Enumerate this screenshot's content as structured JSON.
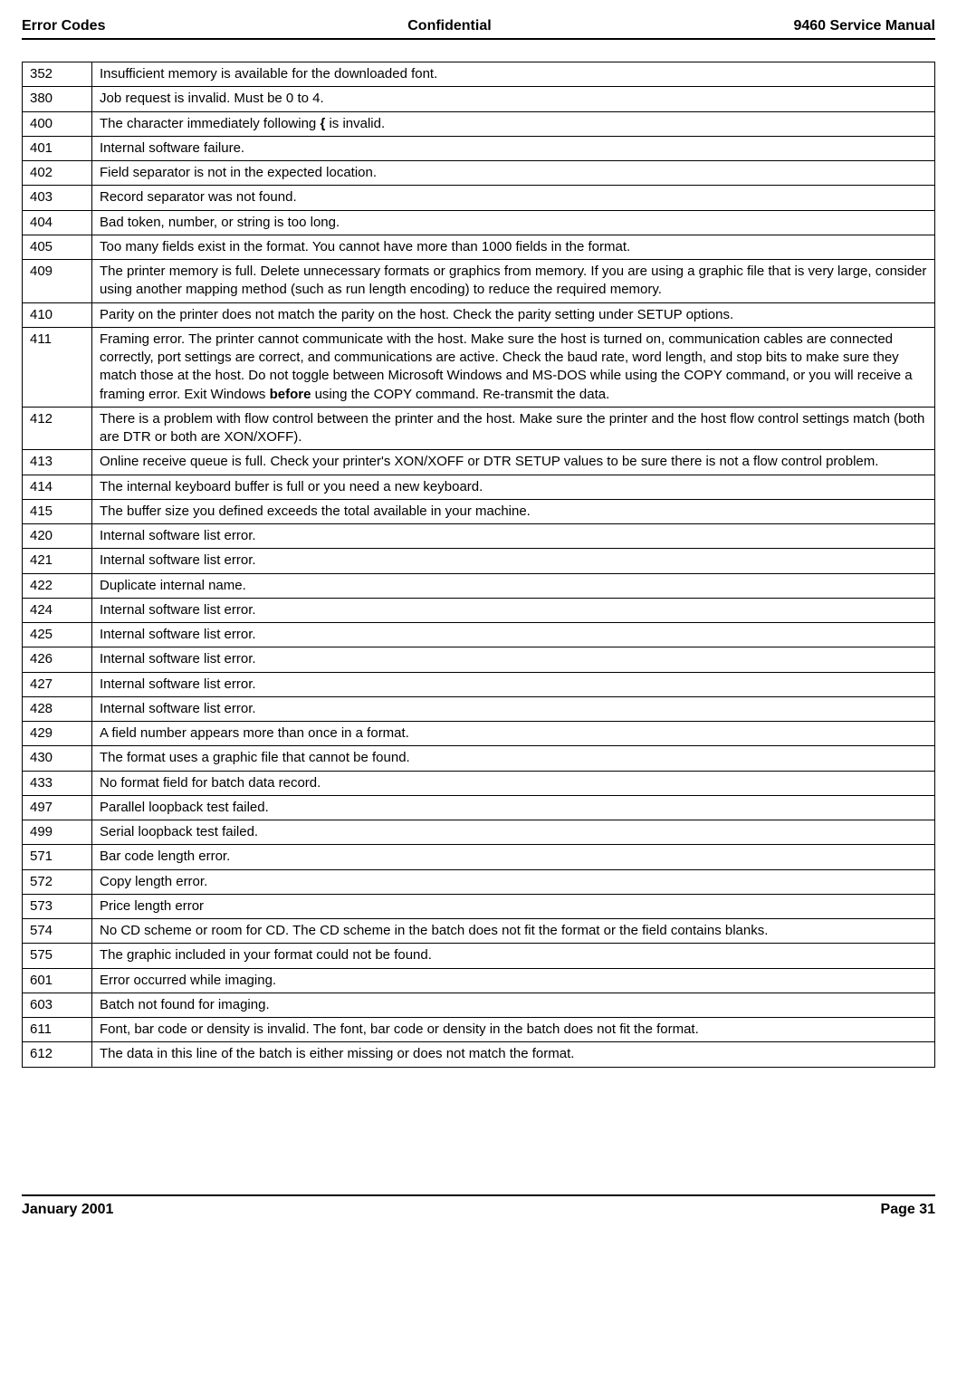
{
  "header": {
    "left": "Error Codes",
    "center": "Confidential",
    "right": "9460 Service Manual"
  },
  "footer": {
    "left": "January 2001",
    "right": "Page 31"
  },
  "rows": [
    {
      "code": "352",
      "desc": "Insufficient memory is available for the downloaded font."
    },
    {
      "code": "380",
      "desc": "Job request is invalid.  Must be 0 to 4."
    },
    {
      "code": "400",
      "desc_html": "The character immediately following <b>{</b> is invalid."
    },
    {
      "code": "401",
      "desc": "Internal software failure."
    },
    {
      "code": "402",
      "desc": "Field separator is not in the expected location."
    },
    {
      "code": "403",
      "desc": "Record separator was not found."
    },
    {
      "code": "404",
      "desc": "Bad token, number, or string is too long."
    },
    {
      "code": "405",
      "desc": "Too many fields exist in the format.  You cannot have more than 1000 fields in the format."
    },
    {
      "code": "409",
      "desc": "The printer memory is full.  Delete unnecessary formats or graphics from memory.  If you are using a graphic file that is very large, consider using another mapping method (such as run length encoding) to reduce the required memory."
    },
    {
      "code": "410",
      "desc": "Parity on the printer does not match the parity on the host.  Check the parity setting under SETUP options."
    },
    {
      "code": "411",
      "desc_html": "Framing error.  The printer cannot communicate with the host.  Make sure the host is turned on, communication cables are connected correctly, port settings are correct, and communications are active.  Check the baud rate, word length, and stop bits to make sure they match those at the host.  Do not toggle between Microsoft Windows and MS-DOS while using the COPY command, or you will receive a framing error.  Exit Windows <b>before</b> using the COPY command.  Re-transmit the data."
    },
    {
      "code": "412",
      "desc": "There is a problem with flow control between the printer and the host.  Make sure the printer and the host flow control settings match (both are DTR or both are XON/XOFF)."
    },
    {
      "code": "413",
      "desc": "Online receive queue is full.  Check your printer's XON/XOFF or DTR SETUP values to be sure there is not a flow control problem."
    },
    {
      "code": "414",
      "desc": "The internal keyboard buffer is full or you need a new keyboard."
    },
    {
      "code": "415",
      "desc": "The buffer size you defined exceeds the total available in your machine."
    },
    {
      "code": "420",
      "desc": "Internal software list error."
    },
    {
      "code": "421",
      "desc": "Internal software list error."
    },
    {
      "code": "422",
      "desc": "Duplicate internal name."
    },
    {
      "code": "424",
      "desc": "Internal software list error."
    },
    {
      "code": "425",
      "desc": "Internal software list error."
    },
    {
      "code": "426",
      "desc": "Internal software list error."
    },
    {
      "code": "427",
      "desc": "Internal software list error."
    },
    {
      "code": "428",
      "desc": "Internal software list error."
    },
    {
      "code": "429",
      "desc": "A field number appears more than once in a format."
    },
    {
      "code": "430",
      "desc": "The format uses a graphic file that cannot be found."
    },
    {
      "code": "433",
      "desc": "No format field for batch data record."
    },
    {
      "code": "497",
      "desc": "Parallel loopback test failed."
    },
    {
      "code": "499",
      "desc": "Serial loopback test failed."
    },
    {
      "code": "571",
      "desc": "Bar code length error."
    },
    {
      "code": "572",
      "desc": "Copy length error."
    },
    {
      "code": "573",
      "desc": "Price length error"
    },
    {
      "code": "574",
      "desc": "No CD scheme or room for CD.  The CD scheme in the batch does not fit the format or the field contains blanks."
    },
    {
      "code": "575",
      "desc": "The graphic included in your format could not be found."
    },
    {
      "code": "601",
      "desc": "Error occurred while imaging."
    },
    {
      "code": "603",
      "desc": "Batch not found for imaging."
    },
    {
      "code": "611",
      "desc": "Font, bar code or density is invalid.  The font, bar code or density in the batch does not fit the format."
    },
    {
      "code": "612",
      "desc": "The data in this line of the batch is either missing or does not match the format."
    }
  ]
}
